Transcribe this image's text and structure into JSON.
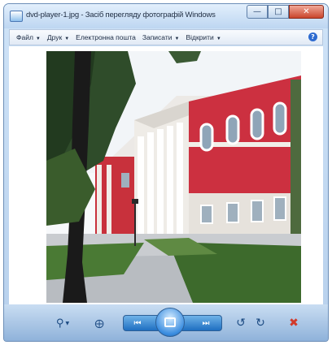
{
  "window": {
    "title": "dvd-player-1.jpg - Засіб перегляду фотографій Windows",
    "icons": {
      "app": "photo-viewer-icon",
      "minimize": "minimize-icon",
      "maximize": "maximize-icon",
      "close": "close-icon"
    }
  },
  "menubar": {
    "items": [
      {
        "label": "Файл",
        "has_dropdown": true
      },
      {
        "label": "Друк",
        "has_dropdown": true
      },
      {
        "label": "Електронна пошта",
        "has_dropdown": false
      },
      {
        "label": "Записати",
        "has_dropdown": true
      },
      {
        "label": "Відкрити",
        "has_dropdown": true
      }
    ],
    "help_icon": "help-icon"
  },
  "viewer": {
    "image": "photo of a red and white classical building with columns, a tree and a paved path"
  },
  "controls": {
    "icons": [
      "zoom-icon",
      "actual-size-icon",
      "previous-icon",
      "slideshow-icon",
      "next-icon",
      "rotate-counterclockwise-icon",
      "rotate-clockwise-icon",
      "delete-icon"
    ]
  },
  "colors": {
    "accent": "#2d6ad0",
    "close": "#c9452c",
    "building_red": "#c8313c"
  }
}
